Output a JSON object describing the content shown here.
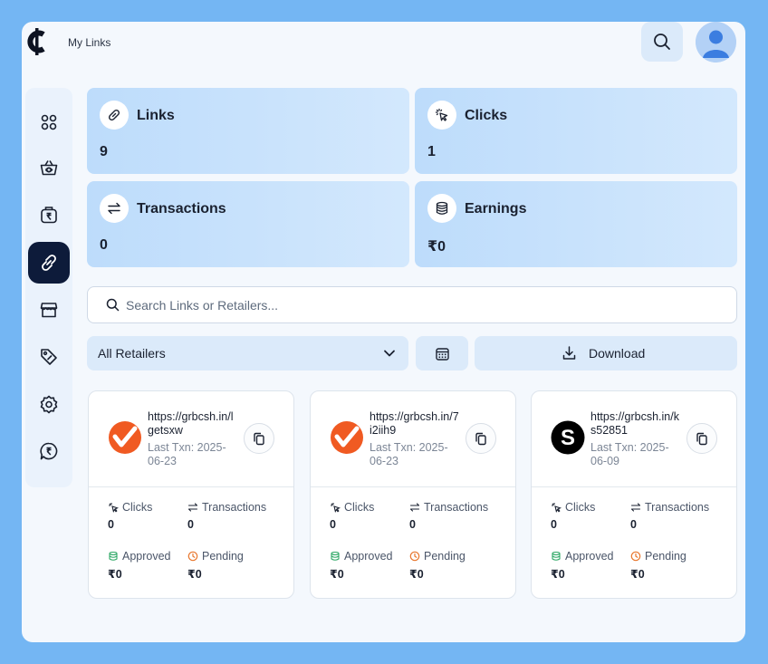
{
  "header": {
    "page_title": "My Links"
  },
  "sidebar": {
    "items": [
      {
        "icon": "grid-icon",
        "label": "dashboard"
      },
      {
        "icon": "basket-icon",
        "label": "shop"
      },
      {
        "icon": "wallet-icon",
        "label": "wallet"
      },
      {
        "icon": "link-icon",
        "label": "links",
        "active": true
      },
      {
        "icon": "store-icon",
        "label": "stores"
      },
      {
        "icon": "tag-icon",
        "label": "offers"
      },
      {
        "icon": "settings-icon",
        "label": "settings"
      },
      {
        "icon": "rupee-chat-icon",
        "label": "support"
      }
    ]
  },
  "stats": {
    "links": {
      "label": "Links",
      "value": "9"
    },
    "clicks": {
      "label": "Clicks",
      "value": "1"
    },
    "transactions": {
      "label": "Transactions",
      "value": "0"
    },
    "earnings": {
      "label": "Earnings",
      "value": "₹0"
    }
  },
  "search": {
    "placeholder": "Search Links or Retailers...",
    "value": ""
  },
  "filters": {
    "retailer_selected": "All Retailers",
    "download_label": "Download"
  },
  "cards": [
    {
      "url": "https://grbcsh.in/lgetsxw",
      "last_txn": "Last Txn: 2025-06-23",
      "logo": "orange-check-logo",
      "clicks_label": "Clicks",
      "clicks": "0",
      "transactions_label": "Transactions",
      "transactions": "0",
      "approved_label": "Approved",
      "approved": "₹0",
      "pending_label": "Pending",
      "pending": "₹0"
    },
    {
      "url": "https://grbcsh.in/7i2iih9",
      "last_txn": "Last Txn: 2025-06-23",
      "logo": "orange-check-logo",
      "clicks_label": "Clicks",
      "clicks": "0",
      "transactions_label": "Transactions",
      "transactions": "0",
      "approved_label": "Approved",
      "approved": "₹0",
      "pending_label": "Pending",
      "pending": "₹0"
    },
    {
      "url": "https://grbcsh.in/ks52851",
      "last_txn": "Last Txn: 2025-06-09",
      "logo": "black-s-logo",
      "clicks_label": "Clicks",
      "clicks": "0",
      "transactions_label": "Transactions",
      "transactions": "0",
      "approved_label": "Approved",
      "approved": "₹0",
      "pending_label": "Pending",
      "pending": "₹0"
    }
  ],
  "colors": {
    "page_bg": "#74b6f3",
    "active_nav": "#0d1b3a",
    "card_accent": "#d3e8fd",
    "brand_orange": "#f05a22"
  }
}
